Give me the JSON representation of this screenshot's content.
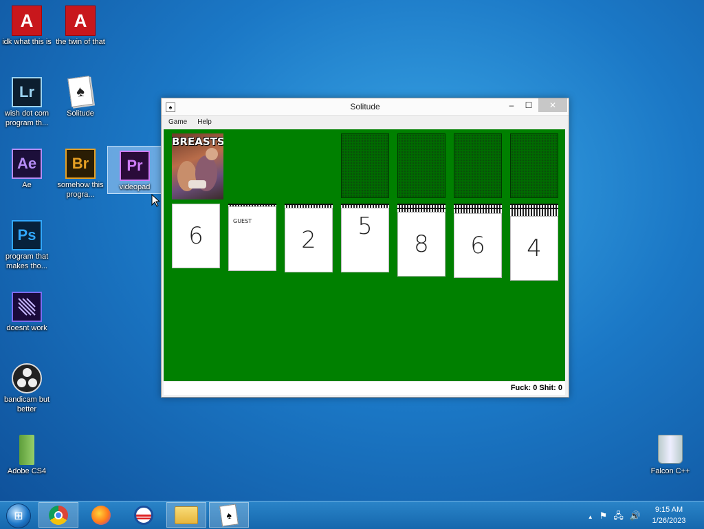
{
  "desktop": {
    "icons": [
      {
        "label": "idk what this is",
        "icon": "adobe-acrobat-icon"
      },
      {
        "label": "the twin of that",
        "icon": "adobe-acrobat-icon"
      },
      {
        "label": "wish dot com program th...",
        "icon": "lightroom-icon"
      },
      {
        "label": "Solitude",
        "icon": "solitaire-icon"
      },
      {
        "label": "Ae",
        "icon": "after-effects-icon"
      },
      {
        "label": "somehow this progra...",
        "icon": "bridge-icon"
      },
      {
        "label": "videopad",
        "icon": "premiere-icon"
      },
      {
        "label": "program that makes tho...",
        "icon": "photoshop-icon"
      },
      {
        "label": "doesnt work",
        "icon": "media-encoder-icon"
      },
      {
        "label": "bandicam but better",
        "icon": "obs-icon"
      },
      {
        "label": "Adobe CS4",
        "icon": "cs4-icon"
      },
      {
        "label": "Falcon C++",
        "icon": "recycle-bin-icon"
      }
    ],
    "glyphs": {
      "adobe": "A",
      "lr": "Lr",
      "ae": "Ae",
      "br": "Br",
      "pr": "Pr",
      "ps": "Ps"
    }
  },
  "window": {
    "title": "Solitude",
    "controls": {
      "minimize": "–",
      "maximize": "☐",
      "close": "✕"
    },
    "menu": [
      "Game",
      "Help"
    ],
    "stock_meme_text": "BREASTS",
    "tableau": [
      {
        "face": "6",
        "backs": 0
      },
      {
        "face": "",
        "small_text": "GUEST",
        "backs": 1
      },
      {
        "face": "2",
        "backs": 1
      },
      {
        "face": "5",
        "backs": 1
      },
      {
        "face": "8",
        "backs": 2
      },
      {
        "face": "6",
        "backs": 2
      },
      {
        "face": "4",
        "backs": 2
      }
    ],
    "status": "Fuck: 0 Shit: 0"
  },
  "taskbar": {
    "apps": [
      "chrome-icon",
      "firefox-icon",
      "obama-logo-icon",
      "file-explorer-icon",
      "solitaire-icon"
    ],
    "tray_icons": [
      "▲",
      "⚑",
      "🖧",
      "🔊"
    ],
    "time": "9:15 AM",
    "date": "1/26/2023"
  }
}
